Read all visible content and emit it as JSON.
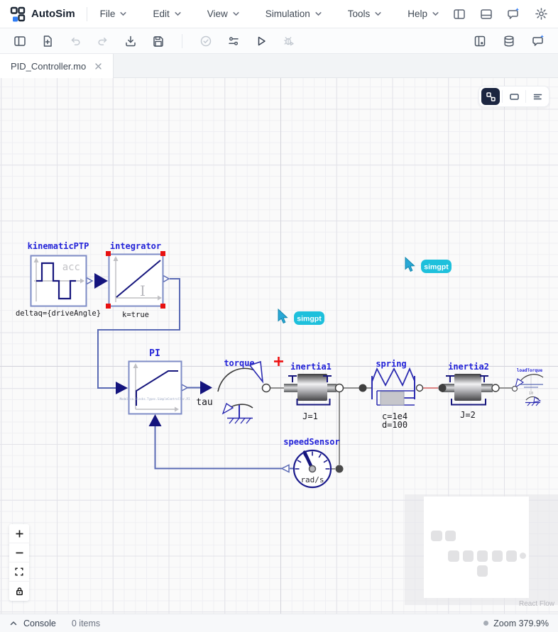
{
  "colors": {
    "accent_blue": "#3b82f6",
    "cursor_cyan": "#1ec0dc",
    "block_label_blue": "#2222d8",
    "diagram_navy": "#16167d",
    "wire_slate": "#5a6ab4",
    "selection_red": "#e81010",
    "spring_wire_red": "#dd8484"
  },
  "header": {
    "app_name": "AutoSim",
    "menus": [
      {
        "label": "File"
      },
      {
        "label": "Edit"
      },
      {
        "label": "View"
      },
      {
        "label": "Simulation"
      },
      {
        "label": "Tools"
      },
      {
        "label": "Help"
      }
    ]
  },
  "tabs": [
    {
      "label": "PID_Controller.mo"
    }
  ],
  "canvas": {
    "blocks": {
      "kinematicPTP": {
        "label": "kinematicPTP",
        "sublabel": "deltaq={driveAngle}",
        "inner": "acc"
      },
      "integrator": {
        "label": "integrator",
        "sublabel": "k=true",
        "inner": "I"
      },
      "pi": {
        "label": "PI",
        "inner": "Modelica.Blocks.Types.SimpleController.PI",
        "output_label": "tau"
      },
      "torque": {
        "label": "torque"
      },
      "inertia1": {
        "label": "inertia1",
        "sublabel": "J=1"
      },
      "spring": {
        "label": "spring",
        "sublabel_c": "c=1e4",
        "sublabel_d": "d=100"
      },
      "inertia2": {
        "label": "inertia2",
        "sublabel": "J=2"
      },
      "speedSensor": {
        "label": "speedSensor",
        "unit": "rad/s"
      },
      "loadTorque": {
        "label": "loadTorque",
        "value": "10"
      }
    },
    "cursors": [
      {
        "label": "simgpt"
      },
      {
        "label": "simgpt"
      }
    ],
    "attribution": "React Flow"
  },
  "statusbar": {
    "console_label": "Console",
    "items_count": "0 items",
    "zoom_label": "Zoom 379.9%"
  }
}
